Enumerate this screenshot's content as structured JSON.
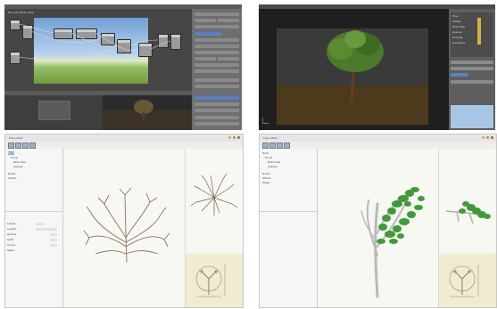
{
  "panels": {
    "blender_nodes": {
      "header_items": [
        "File",
        "Add",
        "Node",
        "View"
      ],
      "node_labels": [
        "Image",
        "Mix",
        "Blur",
        "Output",
        "Scale",
        "Alpha"
      ],
      "prop_buttons": [
        "Render",
        "Layers",
        "Scene",
        "World",
        "Object",
        "Material"
      ]
    },
    "blender_tree": {
      "prop_rows": [
        "Tree",
        "Shape",
        "Branches",
        "Leaves",
        "Pruning",
        "Armature"
      ]
    },
    "tree_editor_1": {
      "title": "tree editor",
      "tree_items": [
        "Root",
        "Trunk",
        "Branches",
        "Leaves",
        "Roots",
        "Stems"
      ],
      "param_rows": [
        "Levels",
        "Length",
        "Radius",
        "Split",
        "Curve",
        "Taper"
      ]
    },
    "tree_editor_2": {
      "title": "tree editor",
      "tree_items": [
        "Root",
        "Trunk",
        "Branches",
        "Leaves",
        "Roots",
        "Stems",
        "Twigs"
      ]
    }
  },
  "colors": {
    "blender_dark": "#3b3b3b",
    "selection": "#5680c2",
    "tree_bark": "#8e6f63",
    "leaf_green": "#3f9b3a",
    "sky": "#a7c6e6"
  }
}
